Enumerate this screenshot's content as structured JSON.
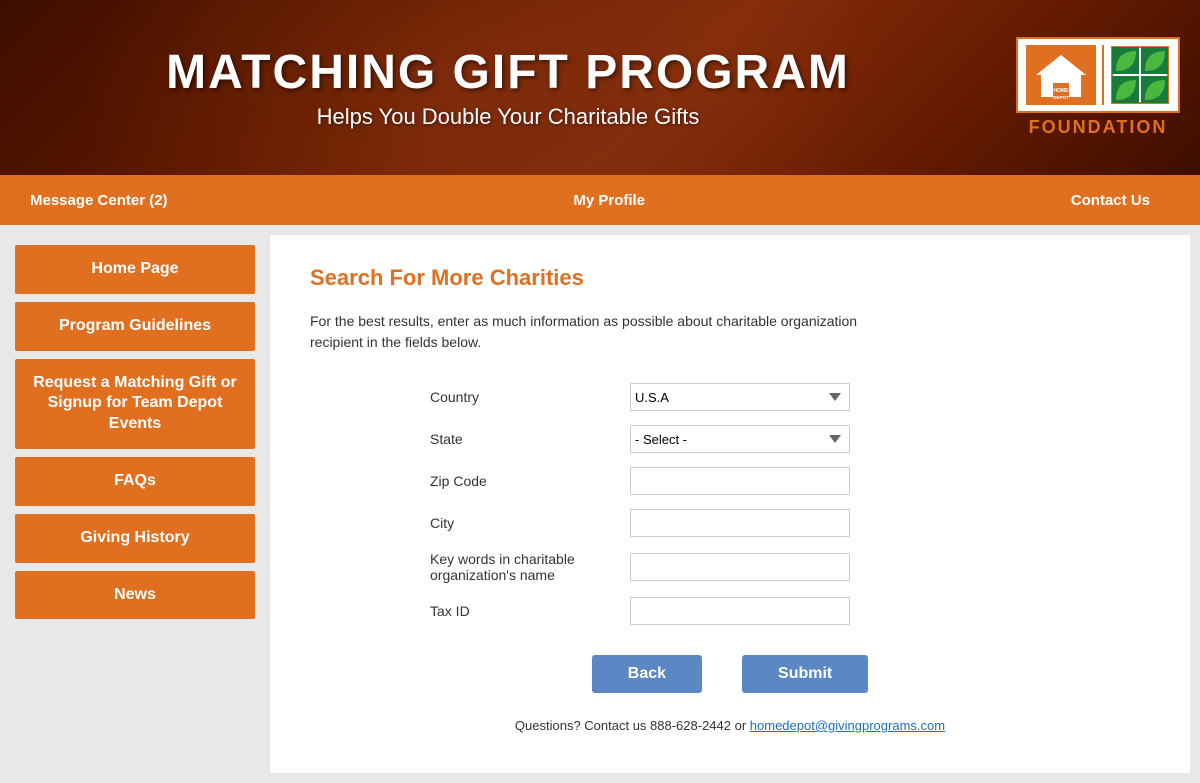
{
  "header": {
    "title": "MATCHING GIFT PROGRAM",
    "subtitle": "Helps You Double Your Charitable Gifts",
    "foundation_label": "FOUNDATION"
  },
  "navbar": {
    "message_center": "Message Center (2)",
    "my_profile": "My Profile",
    "contact_us": "Contact Us"
  },
  "sidebar": {
    "items": [
      {
        "id": "home-page",
        "label": "Home Page"
      },
      {
        "id": "program-guidelines",
        "label": "Program Guidelines"
      },
      {
        "id": "request-matching",
        "label": "Request a Matching Gift or Signup for Team Depot Events"
      },
      {
        "id": "faqs",
        "label": "FAQs"
      },
      {
        "id": "giving-history",
        "label": "Giving History"
      },
      {
        "id": "news",
        "label": "News"
      }
    ]
  },
  "content": {
    "section_title": "Search For More Charities",
    "description": "For the best results, enter as much information as possible about charitable organization recipient in the fields below.",
    "form": {
      "country_label": "Country",
      "country_value": "U.S.A",
      "state_label": "State",
      "state_value": "- Select -",
      "zip_label": "Zip Code",
      "zip_placeholder": "",
      "city_label": "City",
      "city_placeholder": "",
      "keywords_label": "Key words in charitable organization's name",
      "keywords_placeholder": "",
      "tax_id_label": "Tax ID",
      "tax_id_placeholder": ""
    },
    "back_button": "Back",
    "submit_button": "Submit",
    "footer_text": "Questions? Contact us 888-628-2442 or ",
    "footer_email": "homedepot@givingprograms.com",
    "footer_email_href": "mailto:homedepot@givingprograms.com"
  }
}
